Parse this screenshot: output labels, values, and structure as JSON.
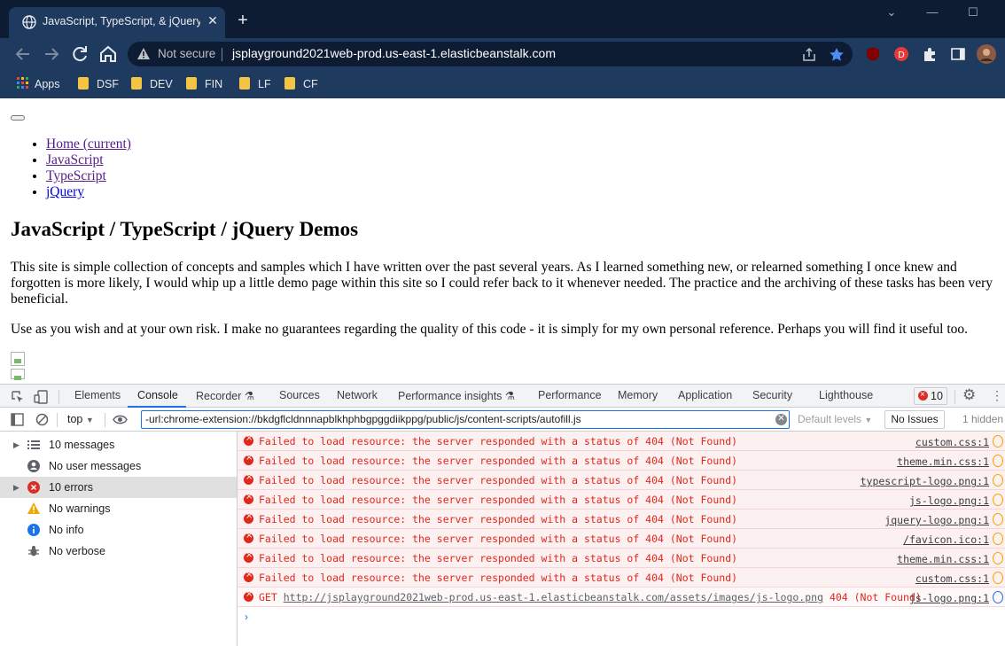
{
  "browser": {
    "tab_title": "JavaScript, TypeScript, & jQuery Demos",
    "new_tab_label": "+",
    "omnibox": {
      "security_label": "Not secure",
      "url": "jsplayground2021web-prod.us-east-1.elasticbeanstalk.com"
    },
    "bookmarks": [
      {
        "label": "Apps",
        "icon": "apps-grid-icon"
      },
      {
        "label": "DSF",
        "icon": "folder-icon"
      },
      {
        "label": "DEV",
        "icon": "folder-icon"
      },
      {
        "label": "FIN",
        "icon": "folder-icon"
      },
      {
        "label": "LF",
        "icon": "folder-icon"
      },
      {
        "label": "CF",
        "icon": "folder-icon"
      }
    ],
    "colors": {
      "frame": "#0d1c33",
      "toolbar": "#1f3a5f",
      "folder": "#f6c445"
    }
  },
  "page": {
    "nav": [
      {
        "label": "Home (current)"
      },
      {
        "label": "JavaScript"
      },
      {
        "label": "TypeScript"
      },
      {
        "label": "jQuery"
      }
    ],
    "heading": "JavaScript / TypeScript / jQuery Demos",
    "paragraphs": [
      "This site is simple collection of concepts and samples which I have written over the past several years. As I learned something new, or relearned something I once knew and forgotten is more likely, I would whip up a little demo page within this site so I could refer back to it whenever needed. The practice and the archiving of these tasks has been very beneficial.",
      "Use as you wish and at your own risk. I make no guarantees regarding the quality of this code - it is simply for my own personal reference. Perhaps you will find it useful too."
    ]
  },
  "devtools": {
    "tabs": [
      "Elements",
      "Console",
      "Recorder",
      "Sources",
      "Network",
      "Performance insights",
      "Performance",
      "Memory",
      "Application",
      "Security",
      "Lighthouse"
    ],
    "active_tab": "Console",
    "error_count": "10",
    "context": "top",
    "filter_value": "-url:chrome-extension://bkdgflcldnnnapblkhphbgpggdiikppg/public/js/content-scripts/autofill.js",
    "levels_label": "Default levels",
    "issues_label": "No Issues",
    "hidden_label": "1 hidden",
    "sidebar": [
      {
        "label": "10 messages",
        "icon": "list-icon",
        "expandable": true
      },
      {
        "label": "No user messages",
        "icon": "user-icon",
        "expandable": false
      },
      {
        "label": "10 errors",
        "icon": "error-icon",
        "expandable": true,
        "selected": true
      },
      {
        "label": "No warnings",
        "icon": "warning-icon",
        "expandable": false
      },
      {
        "label": "No info",
        "icon": "info-icon",
        "expandable": false
      },
      {
        "label": "No verbose",
        "icon": "bug-icon",
        "expandable": false
      }
    ],
    "messages": [
      {
        "text": "Failed to load resource: the server responded with a status of 404 (Not Found)",
        "source": "custom.css:1"
      },
      {
        "text": "Failed to load resource: the server responded with a status of 404 (Not Found)",
        "source": "theme.min.css:1"
      },
      {
        "text": "Failed to load resource: the server responded with a status of 404 (Not Found)",
        "source": "typescript-logo.png:1"
      },
      {
        "text": "Failed to load resource: the server responded with a status of 404 (Not Found)",
        "source": "js-logo.png:1"
      },
      {
        "text": "Failed to load resource: the server responded with a status of 404 (Not Found)",
        "source": "jquery-logo.png:1"
      },
      {
        "text": "Failed to load resource: the server responded with a status of 404 (Not Found)",
        "source": "/favicon.ico:1"
      },
      {
        "text": "Failed to load resource: the server responded with a status of 404 (Not Found)",
        "source": "theme.min.css:1"
      },
      {
        "text": "Failed to load resource: the server responded with a status of 404 (Not Found)",
        "source": "custom.css:1"
      }
    ],
    "get_message": {
      "method": "GET",
      "url": "http://jsplayground2021web-prod.us-east-1.elasticbeanstalk.com/assets/images/js-logo.png",
      "status": "404 (Not Found)",
      "source": "js-logo.png:1"
    },
    "prompt": "›",
    "colors": {
      "error_text": "#e0281b",
      "error_bg": "#fdf0f0",
      "accent": "#1a73e8"
    }
  }
}
